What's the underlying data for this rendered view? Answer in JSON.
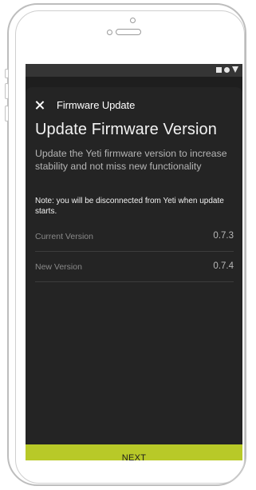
{
  "status_bar": {
    "icons": [
      "square-icon",
      "circle-icon",
      "triangle-icon"
    ]
  },
  "toolbar": {
    "close_icon": "close-icon",
    "title": "Firmware Update"
  },
  "main": {
    "heading": "Update Firmware Version",
    "description": "Update the Yeti firmware version to increase stability and not miss new functionality",
    "note": "Note: you will be disconnected from Yeti when update starts.",
    "rows": [
      {
        "label": "Current Version",
        "value": "0.7.3"
      },
      {
        "label": "New Version",
        "value": "0.7.4"
      }
    ]
  },
  "footer": {
    "next_label": "NEXT"
  },
  "colors": {
    "accent": "#b8c928",
    "background": "#242424",
    "text": "#f2f2f2"
  }
}
